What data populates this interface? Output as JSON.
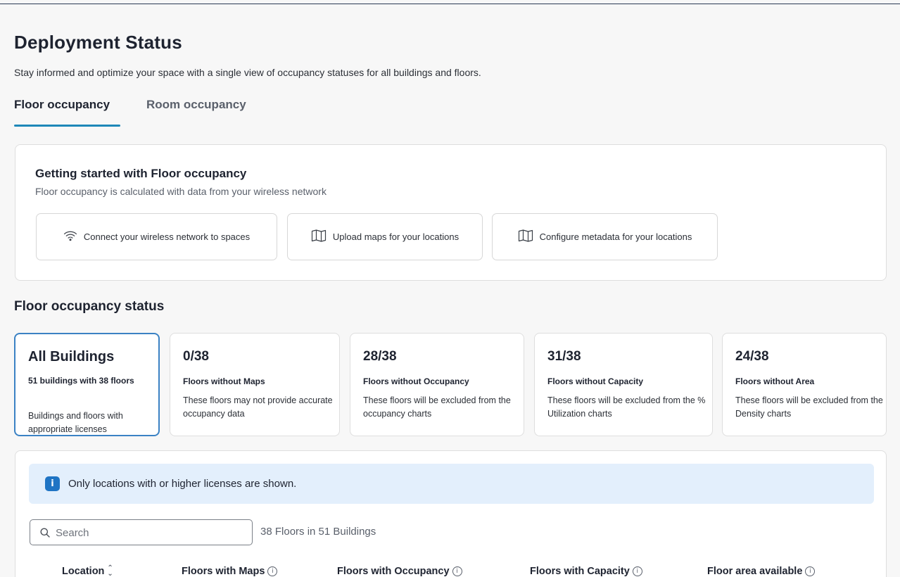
{
  "header": {
    "title": "Deployment Status",
    "subtitle": "Stay informed and optimize your space with a single view of occupancy statuses for all buildings and floors."
  },
  "tabs": [
    {
      "label": "Floor occupancy",
      "selected": true
    },
    {
      "label": "Room occupancy",
      "selected": false
    }
  ],
  "getting_started": {
    "title": "Getting started with Floor occupancy",
    "subtitle": "Floor occupancy is calculated with data from your wireless network",
    "buttons": [
      {
        "label": "Connect your wireless network to spaces",
        "icon": "wifi-icon"
      },
      {
        "label": "Upload maps for your locations",
        "icon": "map-icon"
      },
      {
        "label": "Configure metadata for your locations",
        "icon": "map-icon"
      }
    ]
  },
  "status": {
    "title": "Floor occupancy status",
    "cards": [
      {
        "value": "All Buildings",
        "label": "51 buildings with 38 floors",
        "description": "Buildings and floors with appropriate licenses",
        "selected": true
      },
      {
        "value": "0/38",
        "label": "Floors without Maps",
        "description": "These floors may not provide accurate occupancy data"
      },
      {
        "value": "28/38",
        "label": "Floors without Occupancy",
        "description": "These floors will be excluded from the occupancy charts"
      },
      {
        "value": "31/38",
        "label": "Floors without Capacity",
        "description": "These floors will be excluded from the % Utilization charts"
      },
      {
        "value": "24/38",
        "label": "Floors without Area",
        "description": "These floors will be excluded from the Density charts"
      }
    ]
  },
  "table": {
    "banner": {
      "icon": "info-icon",
      "icon_glyph": "i",
      "text": "Only locations with or higher licenses are shown."
    },
    "search": {
      "placeholder": "Search",
      "value": ""
    },
    "count": "38 Floors in 51 Buildings",
    "columns": [
      {
        "label": "Location",
        "sortable": true
      },
      {
        "label": "Floors with Maps",
        "info": true
      },
      {
        "label": "Floors with Occupancy",
        "info": true
      },
      {
        "label": "Floors with Capacity",
        "info": true
      },
      {
        "label": "Floor area available",
        "info": true
      }
    ]
  },
  "colors": {
    "accent": "#1e88b8",
    "selected_border": "#3b82c4",
    "banner_bg": "#e3effc",
    "info_icon": "#1f74c4"
  }
}
